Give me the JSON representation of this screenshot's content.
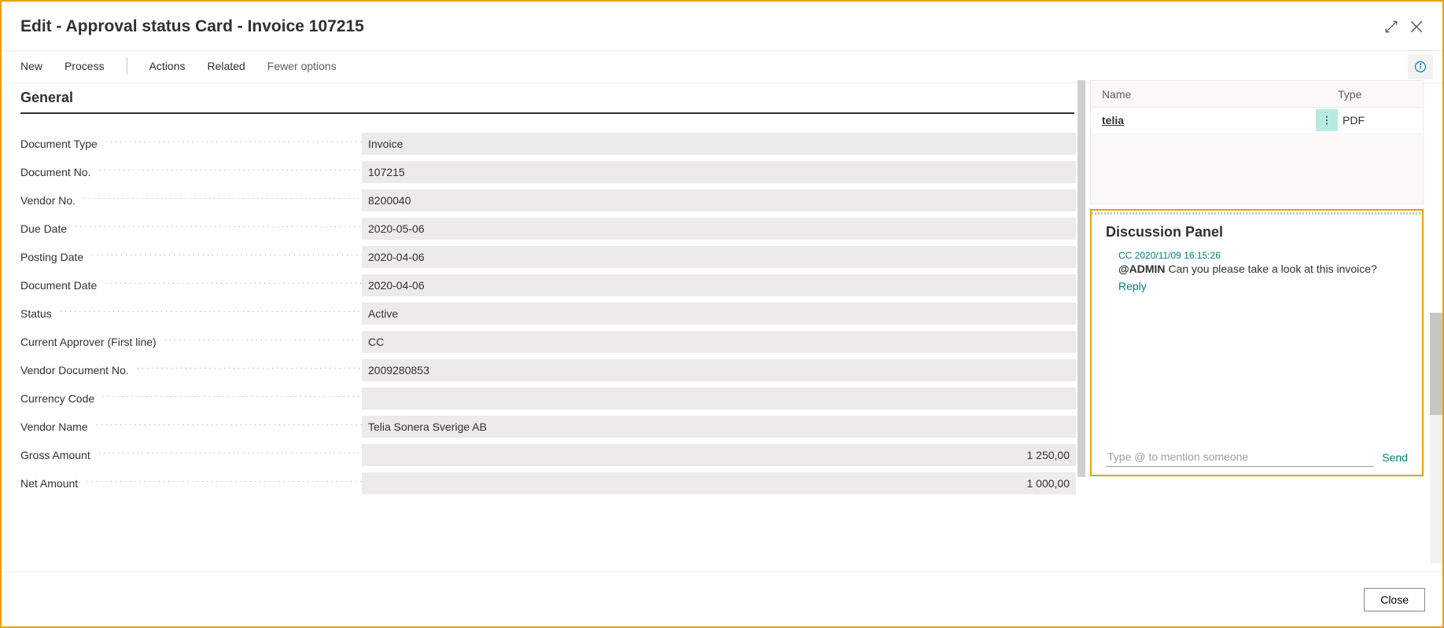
{
  "header": {
    "title": "Edit - Approval status Card - Invoice 107215"
  },
  "toolbar": {
    "new": "New",
    "process": "Process",
    "actions": "Actions",
    "related": "Related",
    "fewer": "Fewer options"
  },
  "general": {
    "title": "General",
    "fields": [
      {
        "label": "Document Type",
        "value": "Invoice",
        "align": "left"
      },
      {
        "label": "Document No.",
        "value": "107215",
        "align": "left"
      },
      {
        "label": "Vendor No.",
        "value": "8200040",
        "align": "left"
      },
      {
        "label": "Due Date",
        "value": "2020-05-06",
        "align": "left"
      },
      {
        "label": "Posting Date",
        "value": "2020-04-06",
        "align": "left"
      },
      {
        "label": "Document Date",
        "value": "2020-04-06",
        "align": "left"
      },
      {
        "label": "Status",
        "value": "Active",
        "align": "left"
      },
      {
        "label": "Current Approver (First line)",
        "value": "CC",
        "align": "left"
      },
      {
        "label": "Vendor Document No.",
        "value": "2009280853",
        "align": "left"
      },
      {
        "label": "Currency Code",
        "value": "",
        "align": "left"
      },
      {
        "label": "Vendor Name",
        "value": "Telia Sonera Sverige AB",
        "align": "left"
      },
      {
        "label": "Gross Amount",
        "value": "1 250,00",
        "align": "right"
      },
      {
        "label": "Net Amount",
        "value": "1 000,00",
        "align": "right"
      }
    ]
  },
  "attachments": {
    "headers": {
      "name": "Name",
      "type": "Type"
    },
    "rows": [
      {
        "name": "telia",
        "type": "PDF"
      }
    ]
  },
  "discussion": {
    "title": "Discussion Panel",
    "comment": {
      "author": "CC",
      "timestamp": "2020/11/09 16:15:26",
      "mention": "@ADMIN",
      "text": "Can you please take a look at this invoice?",
      "reply": "Reply"
    },
    "input_placeholder": "Type @ to mention someone",
    "send": "Send"
  },
  "footer": {
    "close": "Close"
  }
}
